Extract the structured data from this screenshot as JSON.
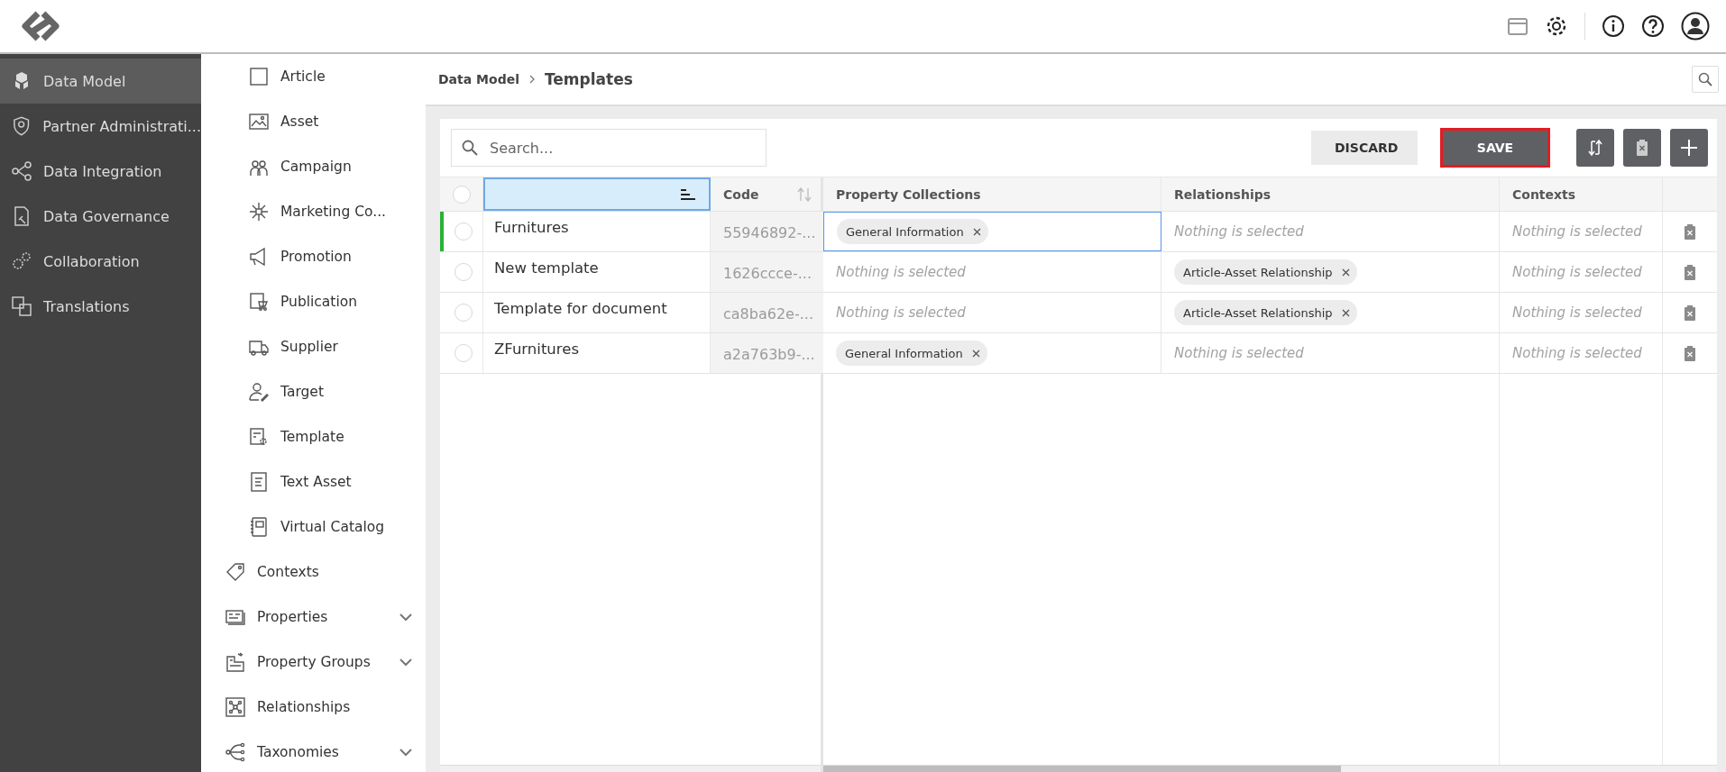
{
  "sidebar": {
    "items": [
      {
        "label": "Data Model",
        "selected": true
      },
      {
        "label": "Partner Administrati...",
        "selected": false
      },
      {
        "label": "Data Integration",
        "selected": false
      },
      {
        "label": "Data Governance",
        "selected": false
      },
      {
        "label": "Collaboration",
        "selected": false
      },
      {
        "label": "Translations",
        "selected": false
      }
    ]
  },
  "nav_panel": {
    "items": [
      {
        "label": "Article",
        "kind": "entity",
        "expandable": false
      },
      {
        "label": "Asset",
        "kind": "entity",
        "expandable": false
      },
      {
        "label": "Campaign",
        "kind": "entity",
        "expandable": false
      },
      {
        "label": "Marketing Co...",
        "kind": "entity",
        "expandable": false
      },
      {
        "label": "Promotion",
        "kind": "entity",
        "expandable": false
      },
      {
        "label": "Publication",
        "kind": "entity",
        "expandable": false
      },
      {
        "label": "Supplier",
        "kind": "entity",
        "expandable": false
      },
      {
        "label": "Target",
        "kind": "entity",
        "expandable": false
      },
      {
        "label": "Template",
        "kind": "entity",
        "expandable": false
      },
      {
        "label": "Text Asset",
        "kind": "entity",
        "expandable": false
      },
      {
        "label": "Virtual Catalog",
        "kind": "entity",
        "expandable": false
      },
      {
        "label": "Contexts",
        "kind": "section",
        "expandable": false
      },
      {
        "label": "Properties",
        "kind": "section",
        "expandable": true
      },
      {
        "label": "Property Groups",
        "kind": "section",
        "expandable": true
      },
      {
        "label": "Relationships",
        "kind": "section",
        "expandable": false
      },
      {
        "label": "Taxonomies",
        "kind": "section",
        "expandable": true
      }
    ]
  },
  "breadcrumb": {
    "parent": "Data Model",
    "current": "Templates"
  },
  "search": {
    "placeholder": "Search..."
  },
  "buttons": [
    {
      "label": "DISCARD",
      "kind": "secondary",
      "highlighted": false
    },
    {
      "label": "SAVE",
      "kind": "primary",
      "highlighted": true
    }
  ],
  "table": {
    "select_all": {
      "checked": false
    },
    "name_column": {
      "selected": true
    },
    "code_column": {
      "label": "Code"
    },
    "columns": [
      "Property Collections",
      "Relationships",
      "Contexts"
    ],
    "rows": [
      {
        "checked": false,
        "active": true,
        "name": "Furnitures",
        "code": "55946892-...",
        "cells": [
          {
            "chips": [
              "General Information"
            ],
            "focused": true
          },
          {
            "empty_text": "Nothing is selected",
            "focused": false
          },
          {
            "empty_text": "Nothing is selected",
            "focused": false
          }
        ]
      },
      {
        "checked": false,
        "active": false,
        "name": "New template",
        "code": "1626ccce-...",
        "cells": [
          {
            "empty_text": "Nothing is selected",
            "focused": false
          },
          {
            "chips": [
              "Article-Asset Relationship"
            ],
            "focused": false
          },
          {
            "empty_text": "Nothing is selected",
            "focused": false
          }
        ]
      },
      {
        "checked": false,
        "active": false,
        "name": "Template for document",
        "code": "ca8ba62e-...",
        "cells": [
          {
            "empty_text": "Nothing is selected",
            "focused": false
          },
          {
            "chips": [
              "Article-Asset Relationship"
            ],
            "focused": false
          },
          {
            "empty_text": "Nothing is selected",
            "focused": false
          }
        ]
      },
      {
        "checked": false,
        "active": false,
        "name": "ZFurnitures",
        "code": "a2a763b9-...",
        "cells": [
          {
            "chips": [
              "General Information"
            ],
            "focused": false
          },
          {
            "empty_text": "Nothing is selected",
            "focused": false
          },
          {
            "empty_text": "Nothing is selected",
            "focused": false
          }
        ]
      }
    ]
  }
}
